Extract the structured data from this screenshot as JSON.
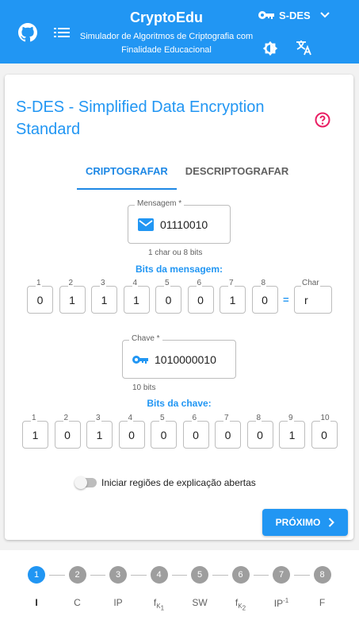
{
  "header": {
    "title": "CryptoEdu",
    "subtitle": "Simulador de Algoritmos de Criptografia com Finalidade Educacional",
    "algorithm": "S-DES"
  },
  "card": {
    "title": "S-DES - Simplified Data Encryption Standard",
    "tabs": [
      "CRIPTOGRAFAR",
      "DESCRIPTOGRAFAR"
    ],
    "message": {
      "label": "Mensagem *",
      "value": "01110010",
      "hint": "1 char ou 8 bits"
    },
    "message_bits_label": "Bits da mensagem:",
    "message_bits": [
      "0",
      "1",
      "1",
      "1",
      "0",
      "0",
      "1",
      "0"
    ],
    "bit_numbers_8": [
      "1",
      "2",
      "3",
      "4",
      "5",
      "6",
      "7",
      "8"
    ],
    "equals": "=",
    "char": {
      "label": "Char",
      "value": "r"
    },
    "key": {
      "label": "Chave *",
      "value": "1010000010",
      "hint": "10 bits"
    },
    "key_bits_label": "Bits da chave:",
    "key_bits": [
      "1",
      "0",
      "1",
      "0",
      "0",
      "0",
      "0",
      "0",
      "1",
      "0"
    ],
    "bit_numbers_10": [
      "1",
      "2",
      "3",
      "4",
      "5",
      "6",
      "7",
      "8",
      "9",
      "10"
    ],
    "toggle_label": "Iniciar regiões de explicação abertas",
    "next_label": "PRÓXIMO"
  },
  "stepper": {
    "numbers": [
      "1",
      "2",
      "3",
      "4",
      "5",
      "6",
      "7",
      "8"
    ],
    "labels": [
      "I",
      "C",
      "IP",
      "fK1",
      "SW",
      "fK2",
      "IP-1",
      "F"
    ],
    "active_index": 0
  },
  "colors": {
    "primary": "#2196f3",
    "help": "#e91e63",
    "inactive_step": "#9e9e9e"
  }
}
